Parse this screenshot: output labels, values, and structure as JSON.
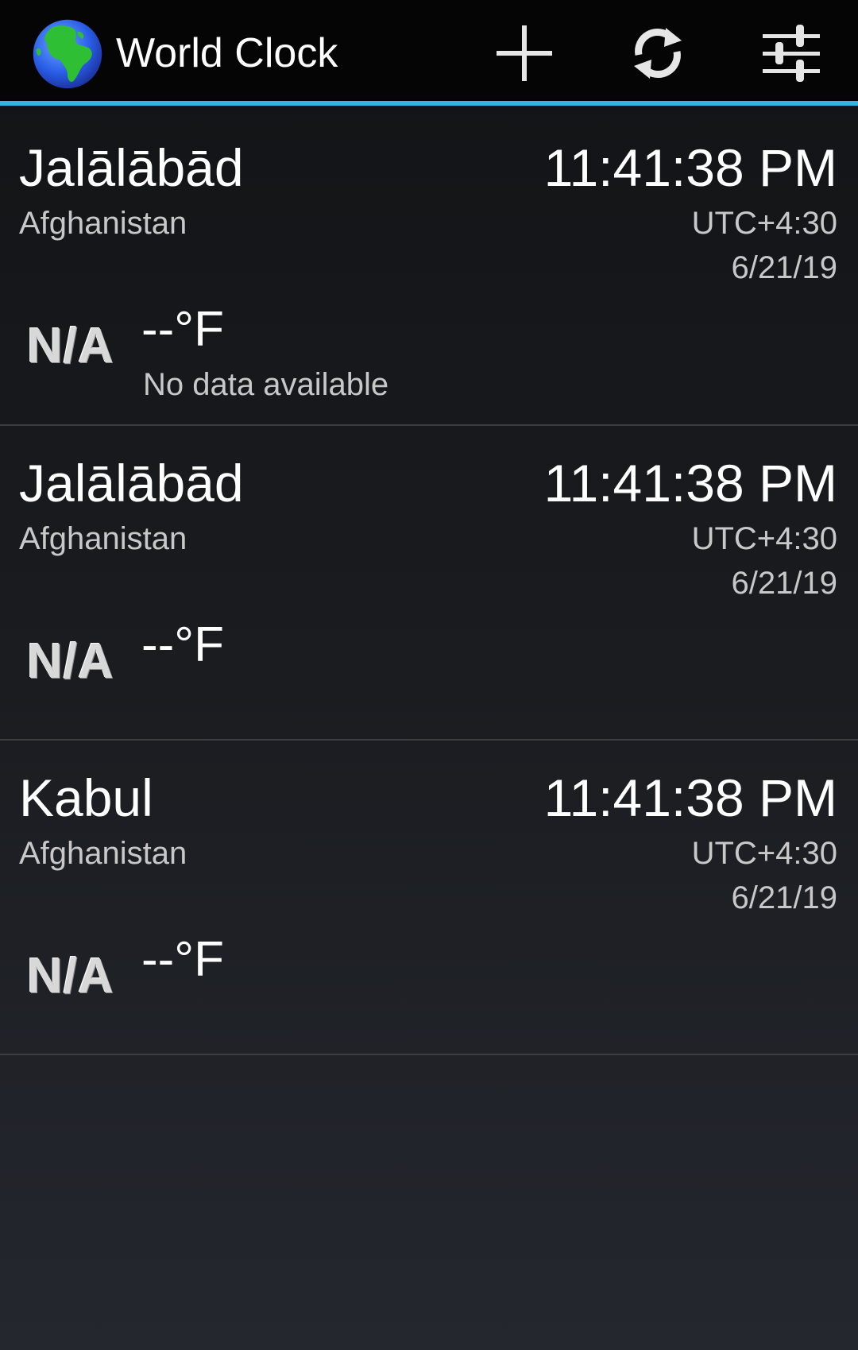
{
  "app": {
    "title": "World Clock",
    "icon": "globe-icon"
  },
  "actions": {
    "add_icon": "plus-icon",
    "refresh_icon": "refresh-icon",
    "settings_icon": "sliders-icon"
  },
  "colors": {
    "accent": "#33b5e5",
    "action_bar_bg": "#050505"
  },
  "clocks": [
    {
      "city": "Jalālābād",
      "country": "Afghanistan",
      "time": "11:41:38 PM",
      "utc_offset": "UTC+4:30",
      "date": "6/21/19",
      "weather_icon": "N/A",
      "temperature": "--°F",
      "condition": "No data available"
    },
    {
      "city": "Jalālābād",
      "country": "Afghanistan",
      "time": "11:41:38 PM",
      "utc_offset": "UTC+4:30",
      "date": "6/21/19",
      "weather_icon": "N/A",
      "temperature": "--°F",
      "condition": ""
    },
    {
      "city": "Kabul",
      "country": "Afghanistan",
      "time": "11:41:38 PM",
      "utc_offset": "UTC+4:30",
      "date": "6/21/19",
      "weather_icon": "N/A",
      "temperature": "--°F",
      "condition": ""
    }
  ]
}
